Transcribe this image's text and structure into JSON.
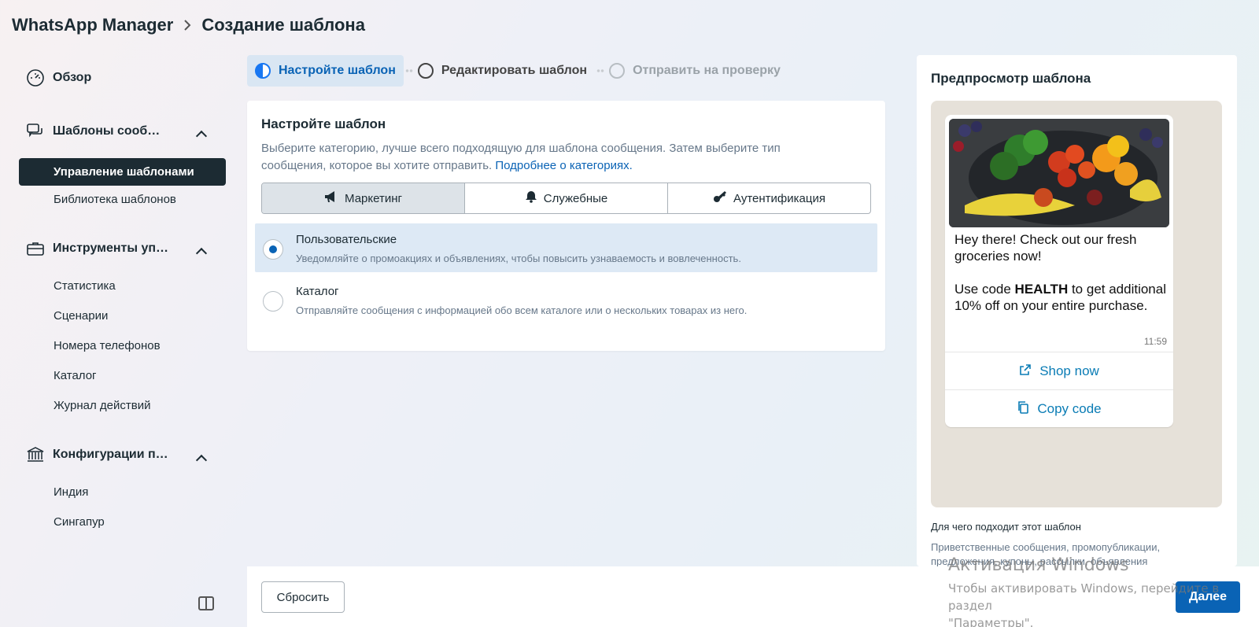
{
  "header": {
    "app": "WhatsApp Manager",
    "page": "Создание шаблона"
  },
  "sidebar": {
    "overview": "Обзор",
    "templates_group": "Шаблоны сооб…",
    "templates_active": "Управление шаблонами",
    "templates_library": "Библиотека шаблонов",
    "tools_group": "Инструменты уп…",
    "tools_items": [
      "Статистика",
      "Сценарии",
      "Номера телефонов",
      "Каталог",
      "Журнал действий"
    ],
    "config_group": "Конфигурации п…",
    "config_items": [
      "Индия",
      "Сингапур"
    ]
  },
  "stepper": {
    "step1": "Настройте шаблон",
    "step2": "Редактировать шаблон",
    "step3": "Отправить на проверку"
  },
  "setup": {
    "title": "Настройте шаблон",
    "desc": "Выберите категорию, лучше всего подходящую для шаблона сообщения. Затем выберите тип сообщения, которое вы хотите отправить.",
    "link": "Подробнее о категориях.",
    "categories": [
      "Маркетинг",
      "Служебные",
      "Аутентификация"
    ],
    "options": [
      {
        "title": "Пользовательские",
        "sub": "Уведомляйте о промоакциях и объявлениях, чтобы повысить узнаваемость и вовлеченность."
      },
      {
        "title": "Каталог",
        "sub": "Отправляйте сообщения с информацией обо всем каталоге или о нескольких товарах из него."
      }
    ]
  },
  "preview": {
    "title": "Предпросмотр шаблона",
    "msg_line1": "Hey there! Check out our fresh groceries now!",
    "msg_pre": "Use code ",
    "msg_bold": "HEALTH",
    "msg_post": " to get additional 10% off on your entire purchase.",
    "time": "11:59",
    "btn_shop": "Shop now",
    "btn_copy": "Copy code",
    "use_title": "Для чего подходит этот шаблон",
    "use_desc": "Приветственные сообщения, промопубликации, предложения, купоны, рассылки, объявления"
  },
  "footer": {
    "reset": "Сбросить",
    "next": "Далее"
  },
  "watermark": {
    "line1": "Активация Windows",
    "line2": "Чтобы активировать Windows, перейдите в раздел",
    "line3": "\"Параметры\"."
  },
  "colors": {
    "accent": "#0a63b5",
    "dark": "#1c2b33",
    "selected_bg": "#dde9f5"
  }
}
